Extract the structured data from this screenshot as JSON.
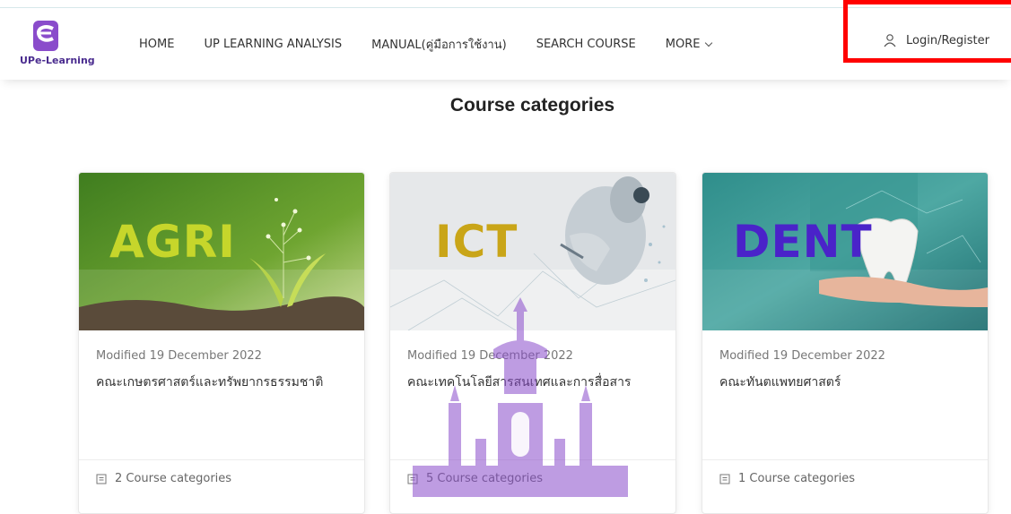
{
  "header": {
    "logo_text": "UPe-Learning",
    "nav": [
      {
        "label": "HOME"
      },
      {
        "label": "UP LEARNING ANALYSIS"
      },
      {
        "label": "MANUAL(คู่มือการใช้งาน)"
      },
      {
        "label": "SEARCH COURSE"
      },
      {
        "label": "MORE"
      }
    ],
    "login_label": "Login/Register"
  },
  "page_title": "Course categories",
  "cards": [
    {
      "banner_text": "AGRI",
      "modified": "Modified 19 December 2022",
      "name": "คณะเกษตรศาสตร์และทรัพยากรธรรมชาติ",
      "count": "2 Course categories"
    },
    {
      "banner_text": "ICT",
      "modified": "Modified 19 December 2022",
      "name": "คณะเทคโนโลยีสารสนเทศและการสื่อสาร",
      "count": "5 Course categories"
    },
    {
      "banner_text": "DENT",
      "modified": "Modified 19 December 2022",
      "name": "คณะทันตแพทยศาสตร์",
      "count": "1 Course categories"
    }
  ],
  "colors": {
    "brand": "#7b3fb5",
    "highlight_border": "#ff0000",
    "agri_text": "#c6d62b",
    "ict_text": "#c9a518",
    "dent_text": "#4a23c9"
  },
  "icons": {
    "user": "user-icon",
    "chevron": "chevron-down-icon",
    "document": "document-icon"
  }
}
